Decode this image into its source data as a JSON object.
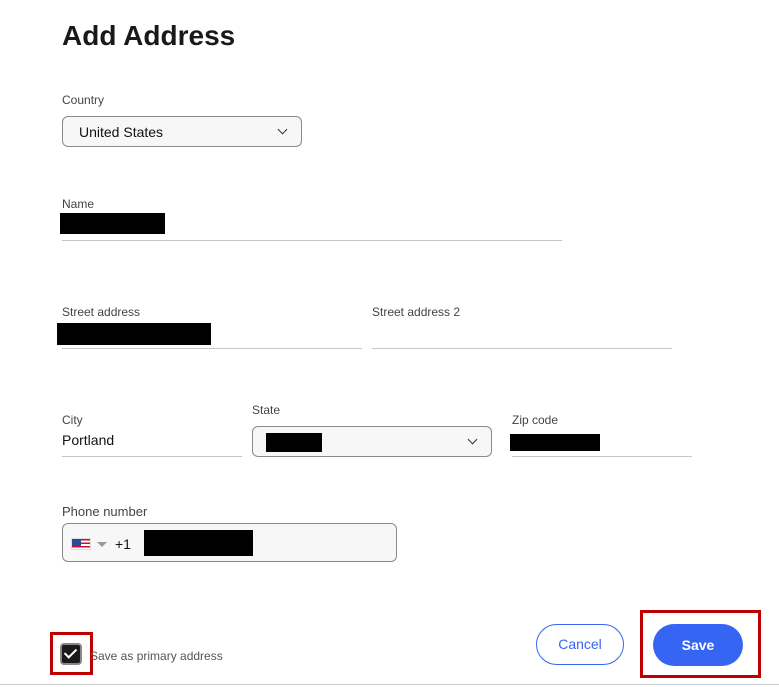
{
  "header": {
    "title": "Add Address"
  },
  "country": {
    "label": "Country",
    "value": "United States"
  },
  "name": {
    "label": "Name",
    "value": ""
  },
  "street": {
    "label": "Street address",
    "value": ""
  },
  "street2": {
    "label": "Street address 2",
    "value": ""
  },
  "city": {
    "label": "City",
    "value": "Portland"
  },
  "state": {
    "label": "State",
    "value": ""
  },
  "zip": {
    "label": "Zip code",
    "value": ""
  },
  "phone": {
    "label": "Phone number",
    "dial_code": "+1",
    "flag_icon": "us-flag-icon",
    "value": ""
  },
  "primary": {
    "label": "Save as primary address",
    "checked": true
  },
  "actions": {
    "cancel_label": "Cancel",
    "save_label": "Save"
  },
  "colors": {
    "accent": "#3665f3",
    "highlight": "#c00000"
  }
}
